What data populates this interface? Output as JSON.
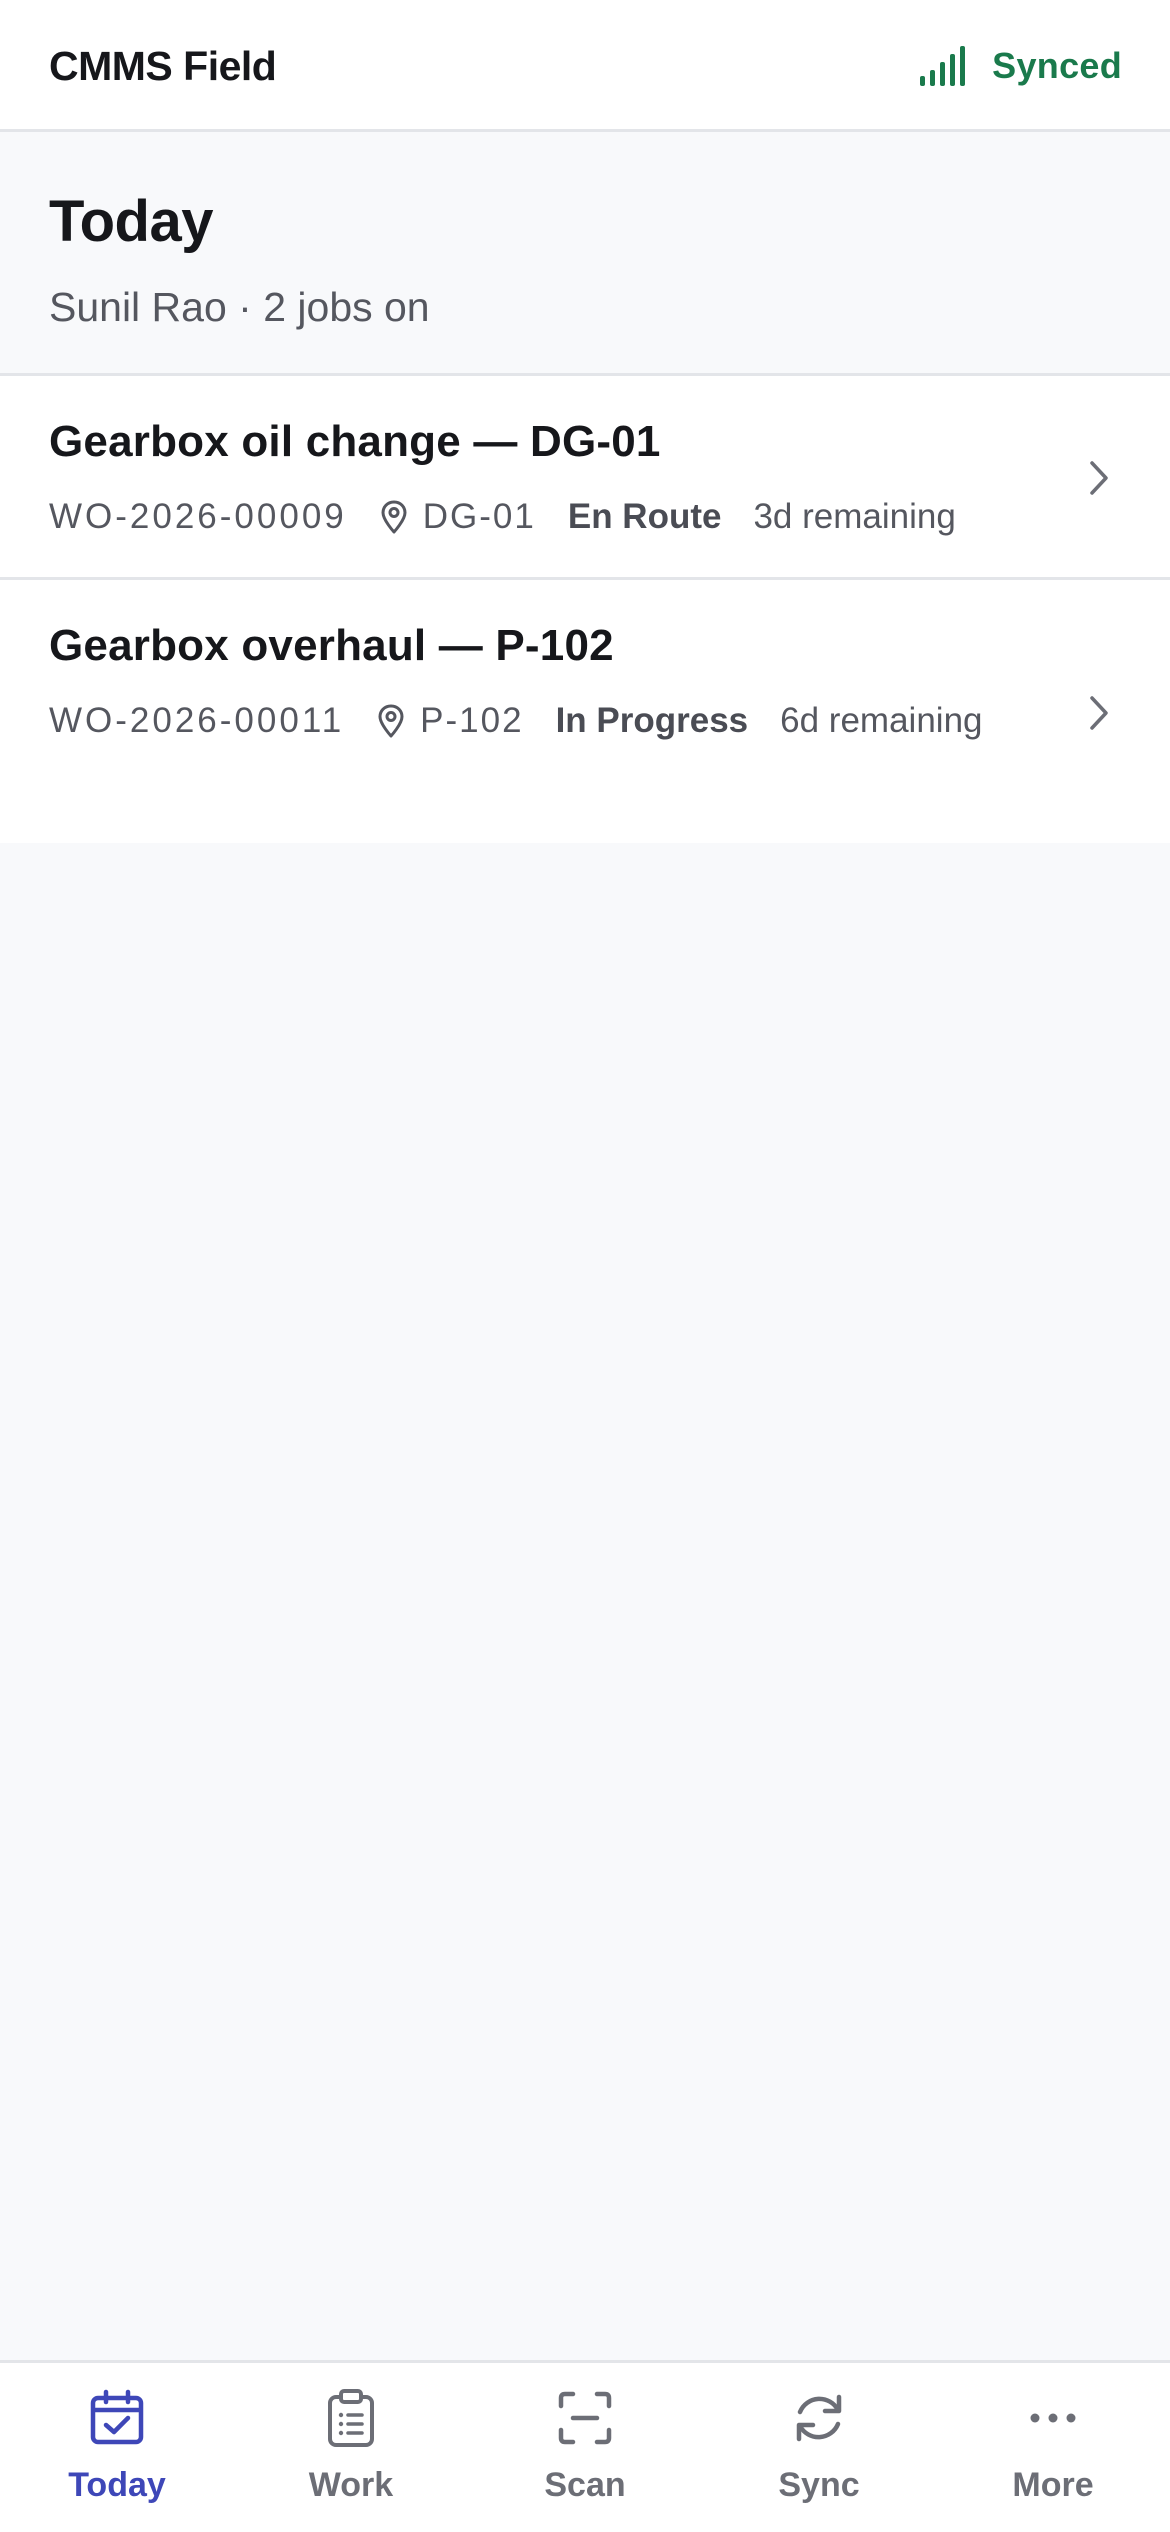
{
  "app": {
    "title": "CMMS Field",
    "sync_status": "Synced",
    "sync_icon": "signal-bars-icon",
    "sync_color": "#1a7a4c"
  },
  "header": {
    "title": "Today",
    "subtitle": "Sunil Rao · 2 jobs on"
  },
  "jobs": [
    {
      "title": "Gearbox oil change — DG-01",
      "wo_number": "WO-2026-00009",
      "asset": "DG-01",
      "status": "En Route",
      "remaining": "3d remaining"
    },
    {
      "title": "Gearbox overhaul — P-102",
      "wo_number": "WO-2026-00011",
      "asset": "P-102",
      "status": "In Progress",
      "remaining": "6d remaining"
    }
  ],
  "nav": {
    "active": "Today",
    "active_color": "#3e47b8",
    "items": [
      {
        "label": "Today",
        "icon": "calendar-check-icon"
      },
      {
        "label": "Work",
        "icon": "clipboard-icon"
      },
      {
        "label": "Scan",
        "icon": "scan-icon"
      },
      {
        "label": "Sync",
        "icon": "refresh-icon"
      },
      {
        "label": "More",
        "icon": "more-dots-icon"
      }
    ]
  }
}
